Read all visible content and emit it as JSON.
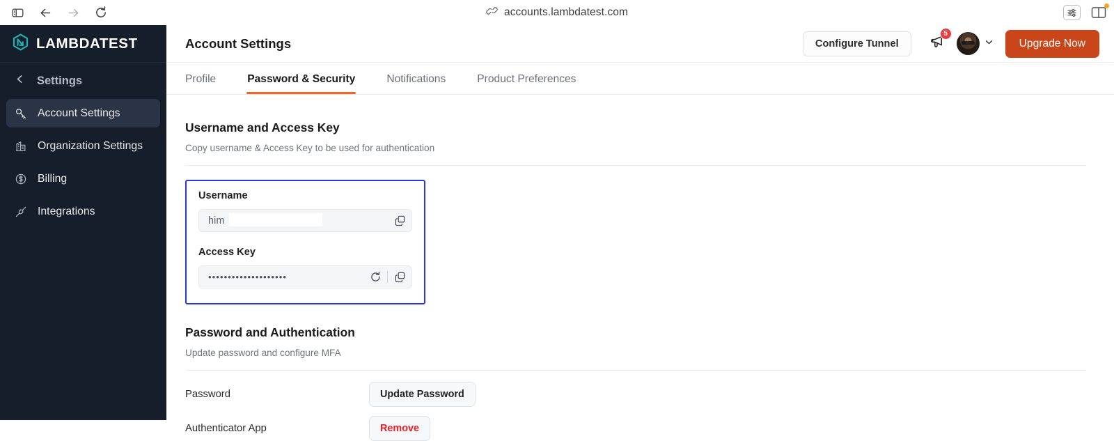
{
  "browser": {
    "url": "accounts.lambdatest.com",
    "url_icon": "link-icon",
    "sidebar_toggle_icon": "sidebar-panel-icon",
    "back_icon": "arrow-left-icon",
    "forward_icon": "arrow-right-icon",
    "reload_icon": "reload-icon",
    "reader_icon": "reader-settings-icon",
    "split_view_icon": "split-view-icon"
  },
  "sidebar": {
    "brand": "LAMBDATEST",
    "brand_logo_icon": "lambdatest-logo-icon",
    "brand_accent": "#18b8b8",
    "back_label": "Settings",
    "back_icon": "chevron-left-icon",
    "items": [
      {
        "label": "Account Settings",
        "icon": "key-icon",
        "active": true
      },
      {
        "label": "Organization Settings",
        "icon": "building-icon",
        "active": false
      },
      {
        "label": "Billing",
        "icon": "dollar-circle-icon",
        "active": false
      },
      {
        "label": "Integrations",
        "icon": "plug-connector-icon",
        "active": false
      }
    ]
  },
  "header": {
    "title": "Account Settings",
    "configure_tunnel_label": "Configure Tunnel",
    "notification_icon": "megaphone-icon",
    "notification_count": "5",
    "notification_badge_color": "#eb3b3b",
    "avatar_icon": "user-avatar",
    "avatar_chevron_icon": "chevron-down-icon",
    "upgrade_label": "Upgrade Now",
    "upgrade_color": "#c8461a"
  },
  "tabs": [
    {
      "label": "Profile",
      "active": false
    },
    {
      "label": "Password & Security",
      "active": true
    },
    {
      "label": "Notifications",
      "active": false
    },
    {
      "label": "Product Preferences",
      "active": false
    }
  ],
  "tab_accent": "#f26522",
  "credentials_section": {
    "title": "Username and Access Key",
    "subtitle": "Copy username & Access Key to be used for authentication",
    "highlight_color": "#2b36e0",
    "username_label": "Username",
    "username_value": "him",
    "username_redacted": true,
    "username_copy_icon": "copy-icon",
    "access_key_label": "Access Key",
    "access_key_value": "••••••••••••••••••••",
    "access_key_regenerate_icon": "refresh-icon",
    "access_key_copy_icon": "copy-icon"
  },
  "auth_section": {
    "title": "Password and Authentication",
    "subtitle": "Update password and configure MFA",
    "rows": [
      {
        "label": "Password",
        "action": "Update Password",
        "danger": false
      },
      {
        "label": "Authenticator App",
        "action": "Remove",
        "danger": true
      }
    ],
    "danger_color": "#ed1c24"
  }
}
